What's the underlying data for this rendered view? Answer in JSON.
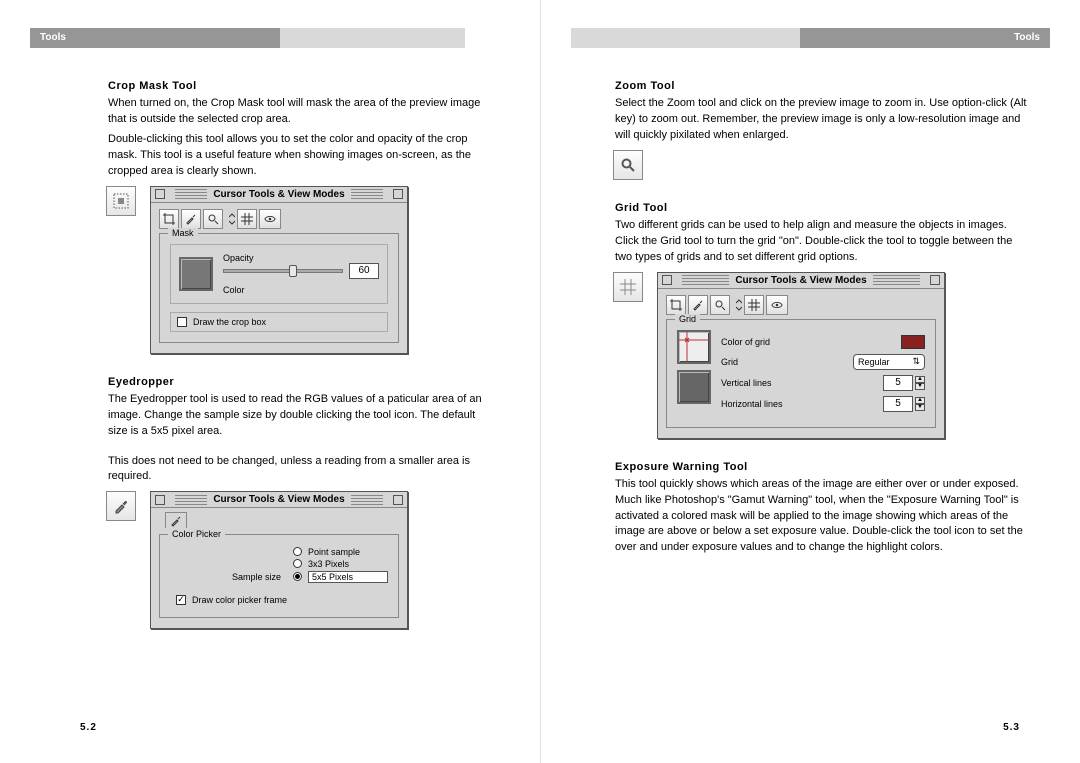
{
  "header": {
    "left_label": "Tools",
    "right_label": "Tools"
  },
  "page_numbers": {
    "left": "5.2",
    "right": "5.3"
  },
  "window_title": "Cursor Tools & View Modes",
  "crop_mask": {
    "heading": "Crop Mask Tool",
    "p1": "When turned on, the Crop Mask tool will mask the area of the preview image that is outside the selected crop area.",
    "p2": "Double-clicking this tool allows you to set the color and opacity of the crop mask. This tool is a useful feature when showing images on-screen, as the cropped area is clearly shown.",
    "group_label": "Mask",
    "opacity_label": "Opacity",
    "opacity_value": "60",
    "color_label": "Color",
    "draw_label": "Draw the crop box"
  },
  "eyedropper": {
    "heading": "Eyedropper",
    "p1": "The Eyedropper tool is used to read the RGB values of a paticular area of an image. Change the sample size by double clicking the tool icon. The default size is a 5x5 pixel area.",
    "p2": "This does not need to be changed, unless a reading from a smaller area is required.",
    "group_label": "Color Picker",
    "sample_size_label": "Sample size",
    "options": {
      "point": "Point sample",
      "three": "3x3 Pixels",
      "five": "5x5 Pixels"
    },
    "draw_frame_label": "Draw color picker frame"
  },
  "zoom": {
    "heading": "Zoom Tool",
    "p1": "Select the Zoom tool and click on the preview image to zoom in. Use option-click (Alt key) to zoom out. Remember, the preview image is only a low-resolution image and will quickly pixilated when enlarged."
  },
  "grid": {
    "heading": "Grid Tool",
    "p1": "Two different grids can be used to help align and measure the objects in images. Click the Grid tool to turn the grid \"on\". Double-click the tool to toggle between the two types of grids and to set different grid options.",
    "group_label": "Grid",
    "color_label": "Color of grid",
    "grid_label": "Grid",
    "grid_value": "Regular",
    "vlines_label": "Vertical lines",
    "vlines_value": "5",
    "hlines_label": "Horizontal lines",
    "hlines_value": "5"
  },
  "exposure": {
    "heading": "Exposure Warning Tool",
    "p1": "This tool quickly shows which areas of the image are either over or under exposed. Much like Photoshop's \"Gamut Warning\" tool, when the \"Exposure Warning Tool\" is activated a colored mask will be applied to the image showing which areas of the image are above or below a set exposure value. Double-click the tool icon to set the over and under exposure values and to change the highlight colors."
  }
}
